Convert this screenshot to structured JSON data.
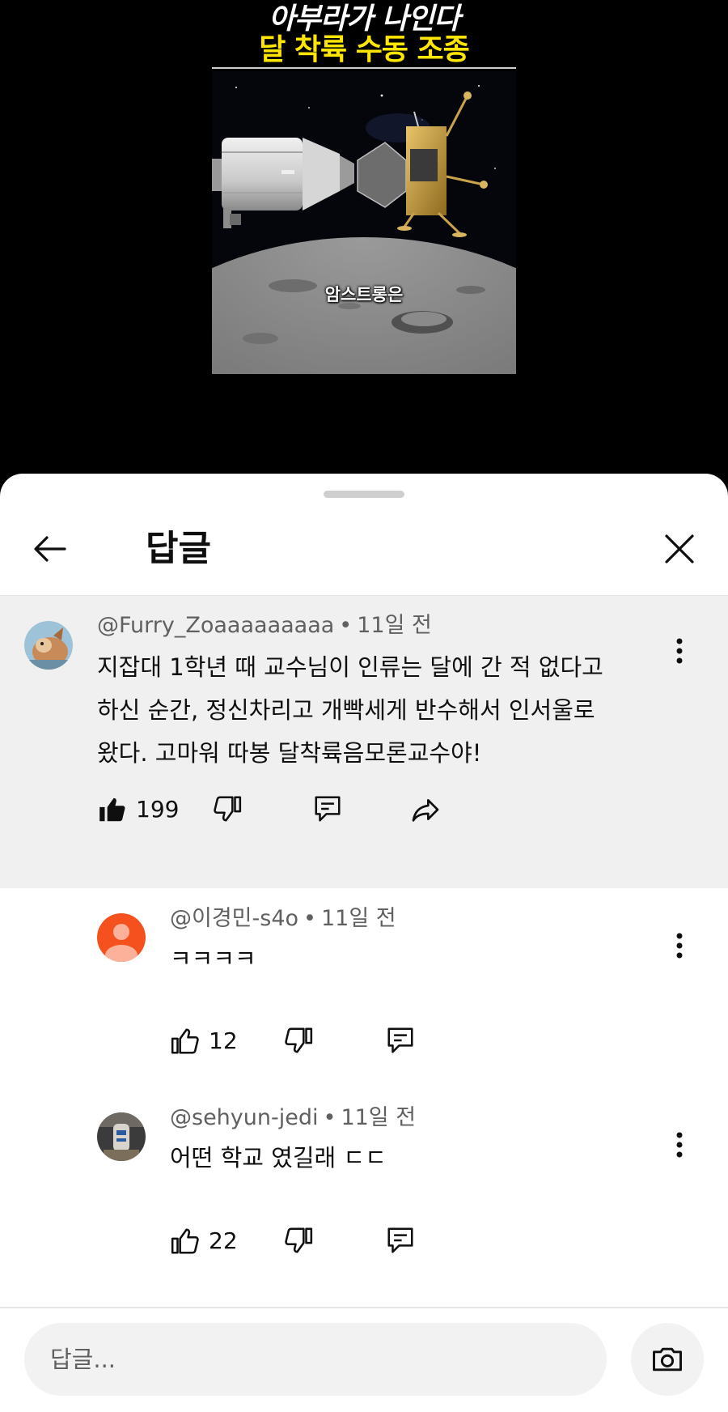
{
  "video": {
    "title_line1": "아부라가 나인다",
    "title_line2": "달 착륙 수동 조종",
    "subtitle": "암스트롱은"
  },
  "header": {
    "title": "답글",
    "back_icon": "arrow-left-icon",
    "close_icon": "close-icon"
  },
  "parent_comment": {
    "author": "@Furry_Zoaaaaaaaaa",
    "sep": "•",
    "time": "11일 전",
    "lines": [
      "지잡대 1학년 때 교수님이 인류는 달에 간 적 없다고",
      "하신 순간, 정신차리고 개빡세게 반수해서 인서울로",
      "왔다. 고마워 따봉 달착륙음모론교수야!"
    ],
    "likes": "199",
    "liked": true
  },
  "replies": [
    {
      "author": "@이경민-s4o",
      "sep": "•",
      "time": "11일 전",
      "text": "ㅋㅋㅋㅋ",
      "likes": "12",
      "avatar_color": "#f4511e"
    },
    {
      "author": "@sehyun-jedi",
      "sep": "•",
      "time": "11일 전",
      "text": "어떤 학교 였길래 ㄷㄷ",
      "likes": "22"
    }
  ],
  "reply_box": {
    "placeholder": "답글...",
    "camera_icon": "camera-icon"
  }
}
